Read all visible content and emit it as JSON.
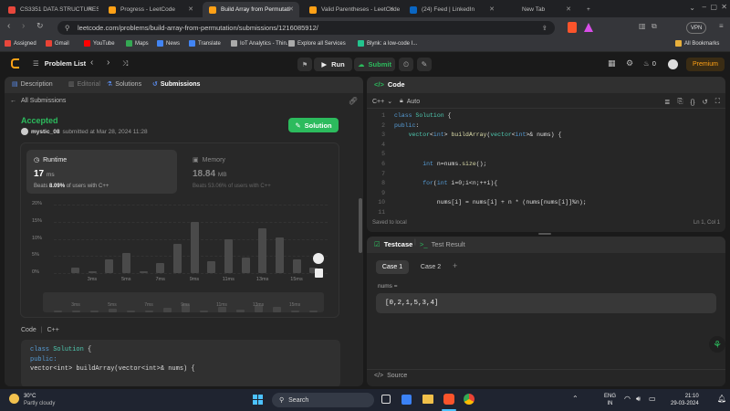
{
  "browser": {
    "tabs": [
      {
        "label": "CS3351 DATA STRUCTURES / U",
        "color": "#e8473c",
        "active": false
      },
      {
        "label": "Progress - LeetCode",
        "color": "#ffa116",
        "active": false
      },
      {
        "label": "Build Array from Permutati",
        "color": "#ffa116",
        "active": true
      },
      {
        "label": "Valid Parentheses - LeetCode",
        "color": "#ffa116",
        "active": false
      },
      {
        "label": "(24) Feed | LinkedIn",
        "color": "#0a66c2",
        "active": false
      },
      {
        "label": "New Tab",
        "color": "",
        "active": false
      }
    ],
    "url": "leetcode.com/problems/build-array-from-permutation/submissions/1216085912/",
    "vpn": "VPN",
    "bookmarks": [
      {
        "label": "Assigned",
        "color": "#e8473c"
      },
      {
        "label": "Gmail",
        "color": "#ea4335"
      },
      {
        "label": "YouTube",
        "color": "#ff0000"
      },
      {
        "label": "Maps",
        "color": "#34a853"
      },
      {
        "label": "News",
        "color": "#4285f4"
      },
      {
        "label": "Translate",
        "color": "#4285f4"
      },
      {
        "label": "IoT Analytics - Thin...",
        "color": "#aaaaaa"
      },
      {
        "label": "Explore all Services",
        "color": "#aaaaaa"
      },
      {
        "label": "Blynk: a low-code I...",
        "color": "#23c48e"
      }
    ],
    "all_bookmarks": "All Bookmarks"
  },
  "lc": {
    "problem_list": "Problem List",
    "run": "Run",
    "submit": "Submit",
    "coins": "0",
    "premium": "Premium"
  },
  "left": {
    "tabs": [
      "Description",
      "Editorial",
      "Solutions",
      "Submissions"
    ],
    "all_submissions": "All Submissions",
    "status": "Accepted",
    "user": "mystic_08",
    "submitted": "submitted at Mar 28, 2024 11:28",
    "solution_btn": "Solution",
    "runtime_label": "Runtime",
    "runtime_value": "17",
    "runtime_unit": "ms",
    "runtime_beats_a": "Beats",
    "runtime_beats_b": "8.09%",
    "runtime_beats_c": "of users with C++",
    "memory_label": "Memory",
    "memory_value": "18.84",
    "memory_unit": "MB",
    "memory_beats": "Beats 53.06% of users with C++",
    "code_label": "Code",
    "code_lang": "C++",
    "code_lines": [
      [
        "class",
        " ",
        "Solution",
        " {"
      ],
      [
        "public:"
      ],
      [
        "    vector<int> buildArray(vector<int>& nums) {"
      ]
    ]
  },
  "chart_data": {
    "type": "bar",
    "yticks": [
      "20%",
      "15%",
      "10%",
      "5%",
      "0%"
    ],
    "ylim": [
      0,
      20
    ],
    "xticks": [
      "3ms",
      "5ms",
      "7ms",
      "9ms",
      "11ms",
      "13ms",
      "15ms"
    ],
    "values": [
      1.5,
      0.5,
      4,
      6,
      0.5,
      3,
      8.5,
      15,
      3.5,
      10,
      4.5,
      13,
      10.5,
      4,
      1.5
    ]
  },
  "editor": {
    "title": "Code",
    "lang": "C++",
    "auto": "Auto",
    "lines": [
      {
        "n": "1",
        "t": "class Solution {"
      },
      {
        "n": "2",
        "t": "public:"
      },
      {
        "n": "3",
        "t": "    vector<int> buildArray(vector<int>& nums) {"
      },
      {
        "n": "4",
        "t": ""
      },
      {
        "n": "5",
        "t": ""
      },
      {
        "n": "6",
        "t": "        int n=nums.size();"
      },
      {
        "n": "7",
        "t": ""
      },
      {
        "n": "8",
        "t": "        for(int i=0;i<n;++i){"
      },
      {
        "n": "9",
        "t": ""
      },
      {
        "n": "10",
        "t": "            nums[i] = nums[i] + n * (nums[nums[i]]%n);"
      },
      {
        "n": "11",
        "t": ""
      }
    ],
    "saved": "Saved to local",
    "position": "Ln 1, Col 1"
  },
  "testcase": {
    "tab1": "Testcase",
    "tab2": "Test Result",
    "case1": "Case 1",
    "case2": "Case 2",
    "add": "+",
    "var_label": "nums =",
    "value": "[0,2,1,5,3,4]",
    "source": "Source"
  },
  "taskbar": {
    "weather_temp": "30°C",
    "weather_desc": "Partly cloudy",
    "search": "Search",
    "lang_top": "ENG",
    "lang_bottom": "IN",
    "time": "21:10",
    "date": "29-03-2024"
  }
}
